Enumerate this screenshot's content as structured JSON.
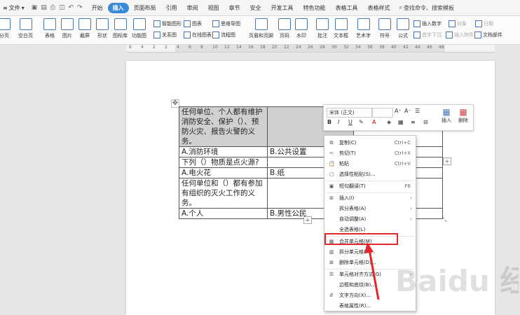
{
  "menubar": {
    "file": "文件",
    "tabs": [
      "开始",
      "插入",
      "页面布局",
      "引用",
      "审阅",
      "视图",
      "章节",
      "安全",
      "开发工具",
      "特色功能",
      "表格工具",
      "表格样式"
    ],
    "active_tab": "插入",
    "search": "查找命令、搜索模板"
  },
  "ribbon": {
    "big": [
      "分页",
      "空白页",
      "表格",
      "图片",
      "截屏",
      "形状",
      "图标库",
      "功能图",
      "页眉和页脚",
      "页码",
      "水印",
      "批注",
      "文本框",
      "艺术字",
      "符号",
      "公式"
    ],
    "small": [
      "智能图形",
      "图表",
      "思维导图",
      "关系图",
      "在线图表",
      "流程图",
      "插入数字",
      "对象",
      "日期",
      "首字下沉",
      "插入附件",
      "文档部件"
    ]
  },
  "ruler_ticks": [
    "6",
    "4",
    "2",
    "2",
    "4",
    "6",
    "8",
    "10",
    "12",
    "14",
    "16",
    "18",
    "20",
    "22",
    "24",
    "26",
    "28",
    "30",
    "32",
    "34",
    "36",
    "38",
    "40",
    "42",
    "44",
    "46",
    "48"
  ],
  "table": {
    "q1": "任何单位、个人都有维护消防安全、保护（）、预防火灾、报告火警的义务。",
    "r2a": "A.消防环境",
    "r2b": "B.公共设置",
    "q2": "下列（）物质是点火源?",
    "r4a": "A.电火花",
    "r4b": "B.纸",
    "q3": "任何单位和（）都有参加有组织的灭火工作的义务。",
    "r6a": "A.个人",
    "r6b": "B.男性公民"
  },
  "mini_toolbar": {
    "font": "宋体 (正文)",
    "insert": "插入",
    "delete": "删除"
  },
  "context_menu": {
    "copy": "复制(C)",
    "copy_key": "Ctrl+C",
    "cut": "剪切(T)",
    "cut_key": "Ctrl+X",
    "paste": "粘贴",
    "paste_key": "Ctrl+V",
    "paste_special": "选择性粘贴(S)...",
    "translate": "短句翻译(T)",
    "translate_key": "F6",
    "insert": "插入(I)",
    "split_table": "拆分表格(A)",
    "autofit": "自动调整(A)",
    "select_all": "全选表格(L)",
    "merge": "合并单元格(M)",
    "split_cells": "拆分单元格(P)...",
    "delete_cells": "删除单元格(D)...",
    "align": "单元格对齐方式(G)",
    "borders": "边框和底纹(B)...",
    "text_dir": "文字方向(X)...",
    "props": "表格属性(R)..."
  },
  "watermark": "Baidu 经验",
  "colors": {
    "accent": "#3b8ad9",
    "highlight": "#e2262b"
  }
}
